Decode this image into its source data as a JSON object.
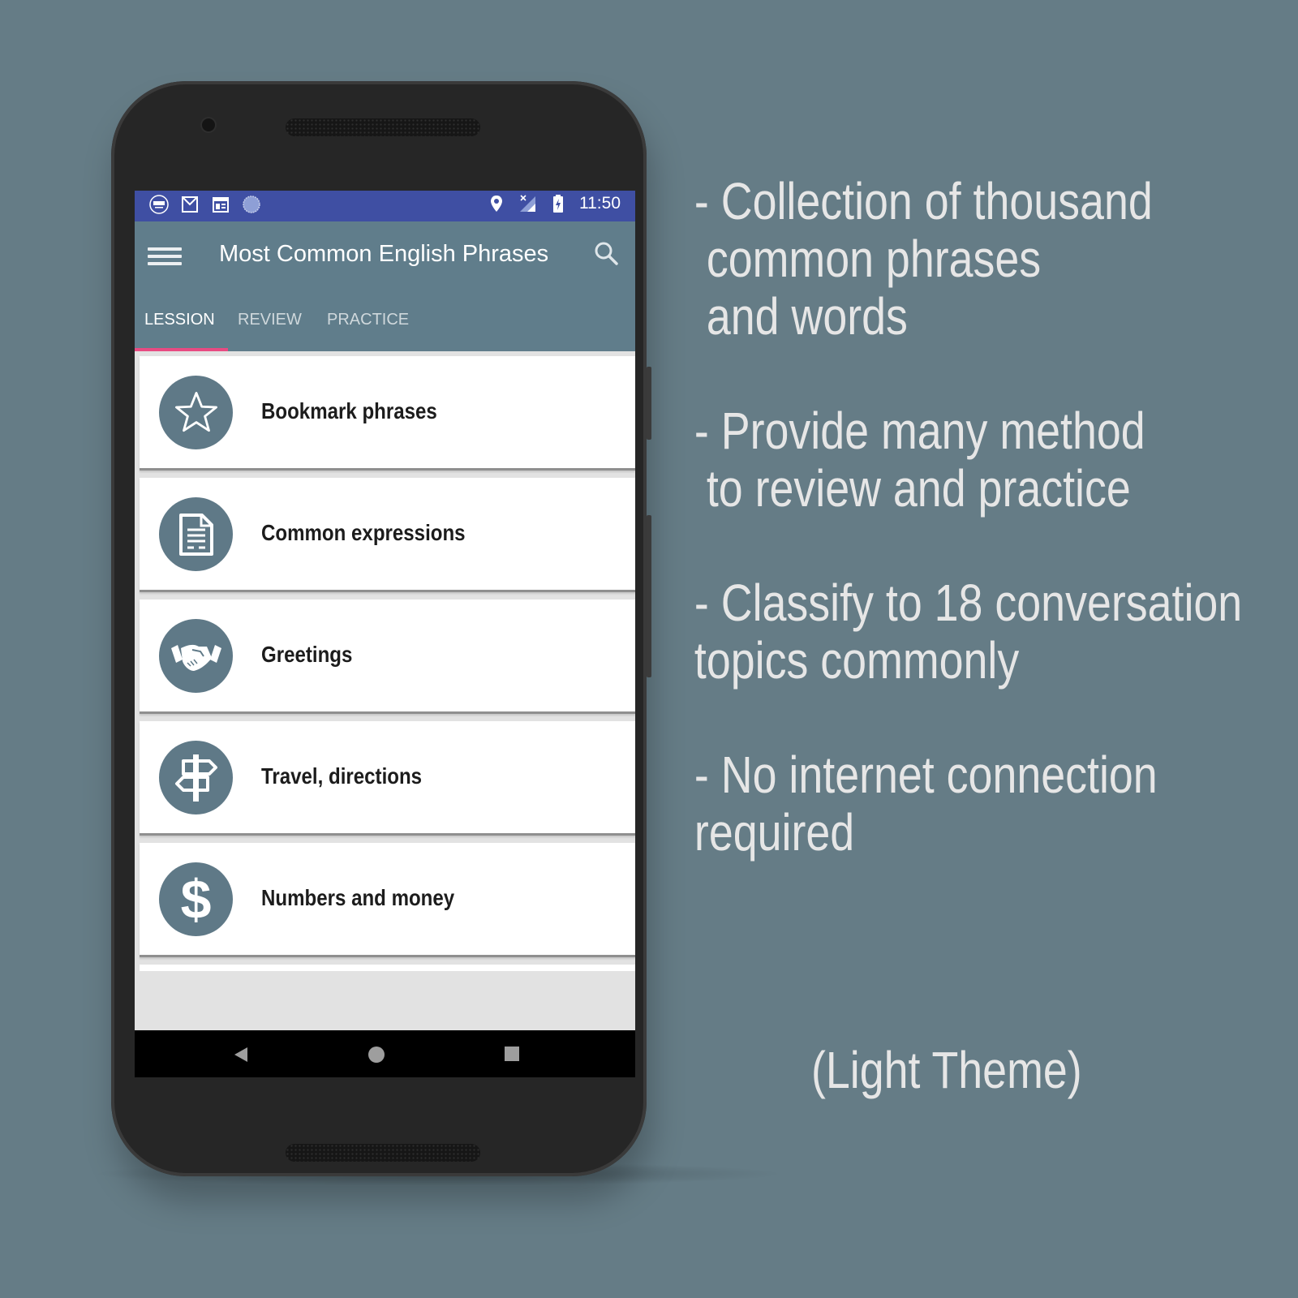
{
  "statusbar": {
    "notification_icons": [
      "app-notification-icon",
      "gmail-icon",
      "calendar-icon",
      "sync-circle-icon"
    ],
    "system_icons": [
      "location-icon",
      "signal-no-data-icon",
      "battery-charging-icon"
    ],
    "time": "11:50"
  },
  "appbar": {
    "title": "Most Common English Phrases",
    "menu_icon": "hamburger-menu-icon",
    "search_icon": "search-icon"
  },
  "tabs": [
    {
      "label": "LESSION",
      "active": true
    },
    {
      "label": "REVIEW",
      "active": false
    },
    {
      "label": "PRACTICE",
      "active": false
    }
  ],
  "lessons": [
    {
      "label": "Bookmark phrases",
      "icon": "star-icon"
    },
    {
      "label": "Common expressions",
      "icon": "document-icon"
    },
    {
      "label": "Greetings",
      "icon": "handshake-icon"
    },
    {
      "label": "Travel, directions",
      "icon": "signpost-icon"
    },
    {
      "label": "Numbers and money",
      "icon": "dollar-icon"
    }
  ],
  "navbar": {
    "back": "back-icon",
    "home": "home-icon",
    "recents": "recents-icon"
  },
  "colors": {
    "background": "#657c86",
    "statusbar": "#3f4fa3",
    "appbar": "#607d8b",
    "tab_indicator": "#e84a82",
    "icon_circle": "#5f7987"
  },
  "features": [
    "- Collection of thousand\n common phrases\n and words",
    "- Provide many method\n to review and practice",
    "- Classify to 18 conversation\ntopics commonly",
    "- No internet connection\nrequired"
  ],
  "theme_note": "(Light Theme)"
}
